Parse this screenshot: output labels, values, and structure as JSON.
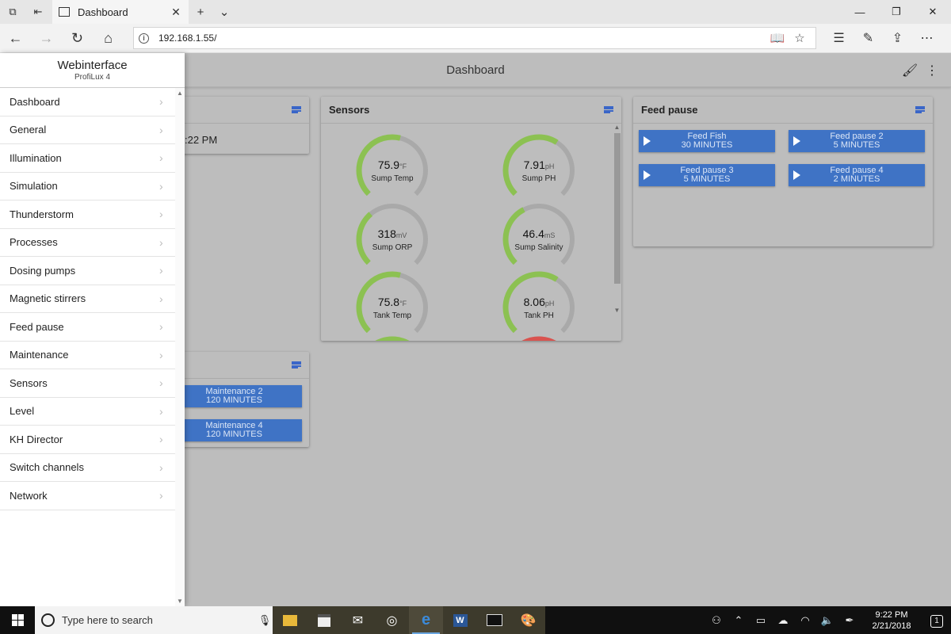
{
  "browser": {
    "tab_title": "Dashboard",
    "tab_icon": "page-icon",
    "url": "192.168.1.55/"
  },
  "app": {
    "title": "Dashboard"
  },
  "sidebar": {
    "title": "Webinterface",
    "subtitle": "ProfiLux 4",
    "items": [
      {
        "label": "Dashboard"
      },
      {
        "label": "General"
      },
      {
        "label": "Illumination"
      },
      {
        "label": "Simulation"
      },
      {
        "label": "Thunderstorm"
      },
      {
        "label": "Processes"
      },
      {
        "label": "Dosing pumps"
      },
      {
        "label": "Magnetic stirrers"
      },
      {
        "label": "Feed pause"
      },
      {
        "label": "Maintenance"
      },
      {
        "label": "Sensors"
      },
      {
        "label": "Level"
      },
      {
        "label": "KH Director"
      },
      {
        "label": "Switch channels"
      },
      {
        "label": "Network"
      }
    ]
  },
  "time_card": {
    "time_text": ":22 PM"
  },
  "sensors_card": {
    "title": "Sensors",
    "gauges": [
      {
        "value": "75.9",
        "unit": "°F",
        "label": "Sump Temp",
        "level": 0.55,
        "color": "#8cc152"
      },
      {
        "value": "7.91",
        "unit": "pH",
        "label": "Sump PH",
        "level": 0.62,
        "color": "#8cc152"
      },
      {
        "value": "318",
        "unit": "mV",
        "label": "Sump ORP",
        "level": 0.35,
        "color": "#8cc152"
      },
      {
        "value": "46.4",
        "unit": "mS",
        "label": "Sump Salinity",
        "level": 0.4,
        "color": "#8cc152"
      },
      {
        "value": "75.8",
        "unit": "°F",
        "label": "Tank Temp",
        "level": 0.55,
        "color": "#8cc152"
      },
      {
        "value": "8.06",
        "unit": "pH",
        "label": "Tank PH",
        "level": 0.62,
        "color": "#8cc152"
      }
    ]
  },
  "feed_card": {
    "title": "Feed pause",
    "buttons": [
      {
        "name": "Feed Fish",
        "duration": "30 MINUTES"
      },
      {
        "name": "Feed pause 2",
        "duration": "5 MINUTES"
      },
      {
        "name": "Feed pause 3",
        "duration": "5 MINUTES"
      },
      {
        "name": "Feed pause 4",
        "duration": "2 MINUTES"
      }
    ]
  },
  "maintenance_card": {
    "buttons": [
      {
        "name": "Maintenance 2",
        "duration": "120 MINUTES"
      },
      {
        "name": "Maintenance 4",
        "duration": "120 MINUTES"
      }
    ]
  },
  "taskbar": {
    "search_placeholder": "Type here to search",
    "time": "9:22 PM",
    "date": "2/21/2018",
    "notifications": "1"
  }
}
